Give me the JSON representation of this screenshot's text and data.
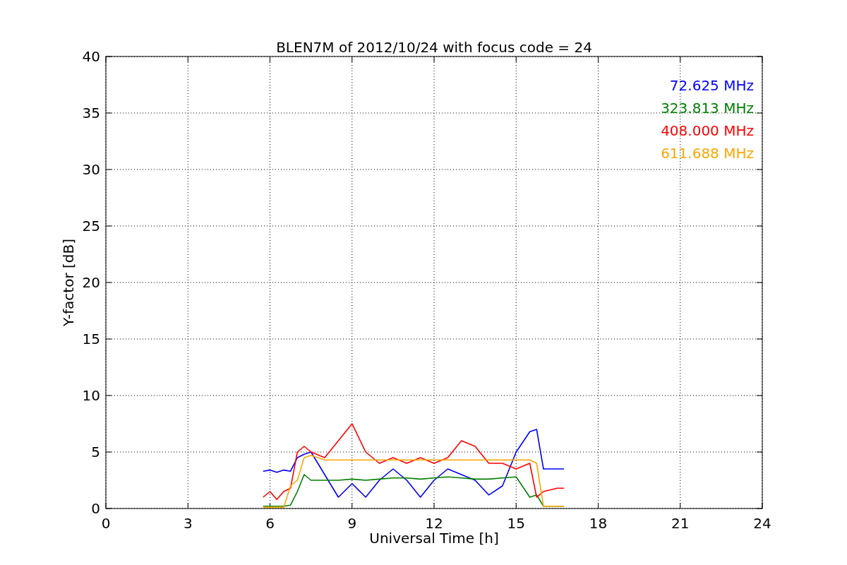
{
  "figure": {
    "chart_data": {
      "type": "line",
      "title": "BLEN7M of 2012/10/24 with focus code = 24",
      "xlabel": "Universal Time [h]",
      "ylabel": "Y-factor [dB]",
      "xlim": [
        0,
        24
      ],
      "ylim": [
        0,
        40
      ],
      "xticks": [
        0,
        3,
        6,
        9,
        12,
        15,
        18,
        21,
        24
      ],
      "yticks": [
        0,
        5,
        10,
        15,
        20,
        25,
        30,
        35,
        40
      ],
      "grid": true,
      "x": [
        5.75,
        6,
        6.25,
        6.5,
        6.75,
        7,
        7.25,
        7.5,
        8,
        8.5,
        9,
        9.5,
        10,
        10.5,
        11,
        11.5,
        12,
        12.5,
        13,
        13.5,
        14,
        14.5,
        15,
        15.5,
        15.75,
        16,
        16.5,
        16.75
      ],
      "series": [
        {
          "name": "72.625 MHz",
          "color": "#0000ff",
          "values": [
            3.3,
            3.4,
            3.2,
            3.4,
            3.3,
            4.5,
            4.8,
            5,
            3,
            1,
            2.2,
            1,
            2.5,
            3.5,
            2.5,
            1,
            2.5,
            3.5,
            3,
            2.5,
            1.2,
            2,
            5,
            6.8,
            7,
            3.5,
            3.5,
            3.5
          ]
        },
        {
          "name": "323.813 MHz",
          "color": "#008000",
          "values": [
            0.2,
            0.2,
            0.2,
            0.2,
            0.3,
            1.5,
            3,
            2.5,
            2.5,
            2.5,
            2.6,
            2.5,
            2.6,
            2.7,
            2.7,
            2.6,
            2.7,
            2.8,
            2.7,
            2.6,
            2.6,
            2.7,
            2.8,
            1,
            1.2,
            0.2,
            0.2,
            0.2
          ]
        },
        {
          "name": "408.000 MHz",
          "color": "#ff0000",
          "values": [
            1,
            1.5,
            0.8,
            1.5,
            1.8,
            5,
            5.5,
            5,
            4.5,
            6,
            7.5,
            5,
            4,
            4.5,
            4,
            4.5,
            4,
            4.5,
            6,
            5.5,
            4,
            4,
            3.5,
            4,
            1,
            1.5,
            1.8,
            1.8
          ]
        },
        {
          "name": "611.688 MHz",
          "color": "#ffa500",
          "values": [
            0.1,
            0.1,
            0.1,
            0.1,
            2,
            2.5,
            4.5,
            4.7,
            4.3,
            4.3,
            4.3,
            4.3,
            4.3,
            4.3,
            4.3,
            4.3,
            4.3,
            4.3,
            4.3,
            4.3,
            4.3,
            4.3,
            4.3,
            4.3,
            4,
            0.2,
            0.2,
            0.2
          ]
        }
      ]
    }
  }
}
